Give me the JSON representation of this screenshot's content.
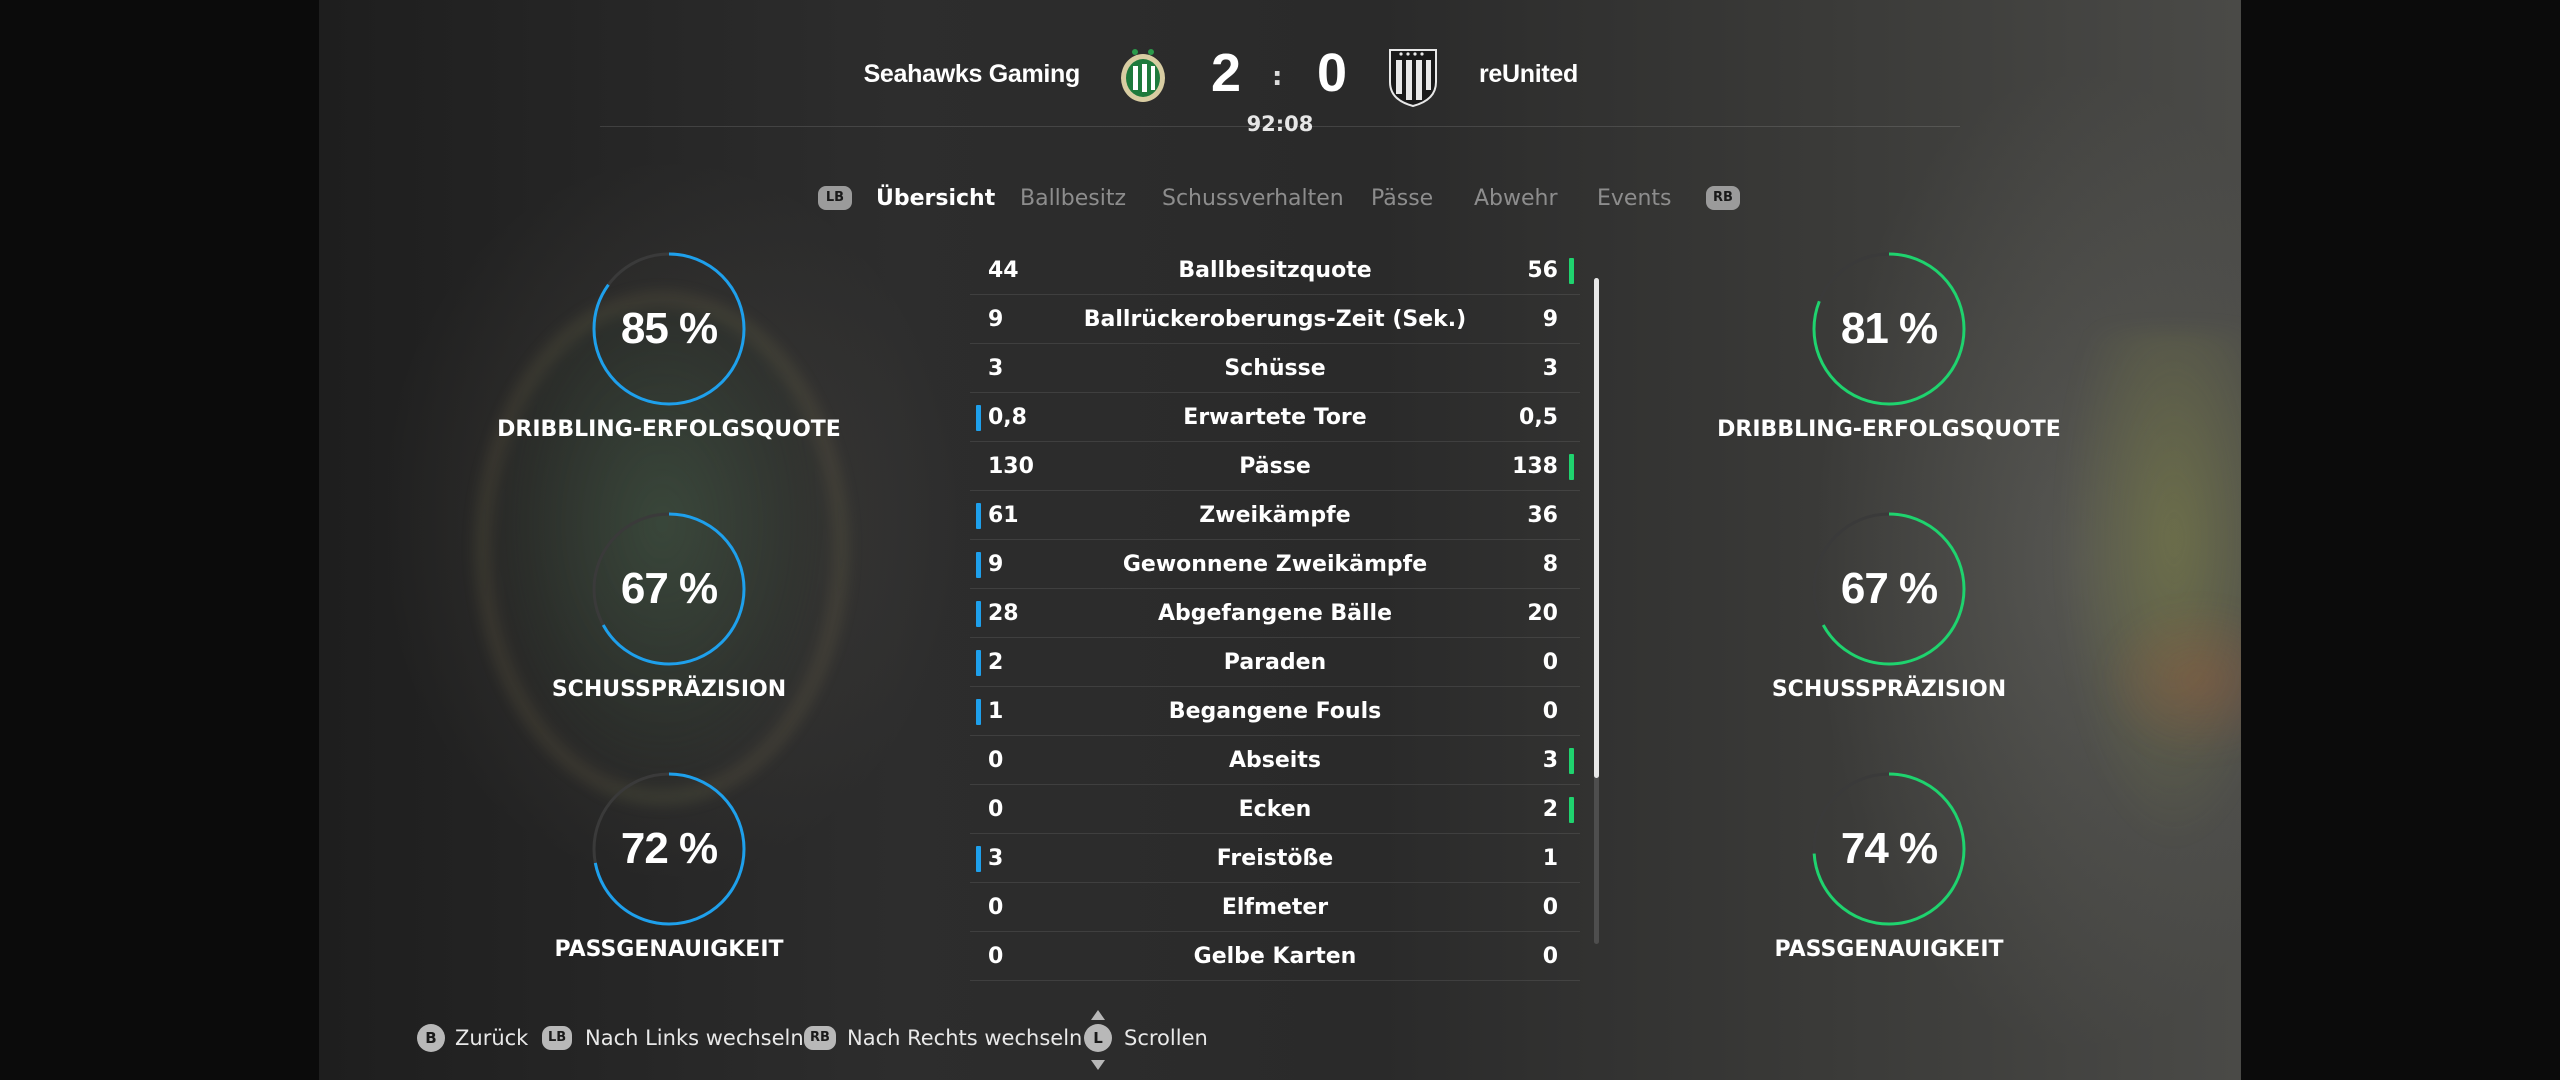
{
  "colors": {
    "home_accent": "#1ea0ec",
    "away_accent": "#1fd36e",
    "track": "#3a3a3a"
  },
  "match": {
    "home_team": "Seahawks Gaming",
    "away_team": "reUnited",
    "home_score": "2",
    "separator": ":",
    "away_score": "0",
    "clock": "92:08",
    "home_crest_icon": "green-white-club-crest-icon",
    "away_crest_icon": "black-white-striped-shield-crest-icon"
  },
  "tabs": {
    "left_button": "LB",
    "right_button": "RB",
    "items": [
      "Übersicht",
      "Ballbesitz",
      "Schussverhalten",
      "Pässe",
      "Abwehr",
      "Events"
    ],
    "active": "Übersicht"
  },
  "home_gauges": [
    {
      "value": "85 %",
      "fraction": 0.85,
      "label": "DRIBBLING-ERFOLGSQUOTE"
    },
    {
      "value": "67 %",
      "fraction": 0.67,
      "label": "SCHUSSPRÄZISION"
    },
    {
      "value": "72 %",
      "fraction": 0.72,
      "label": "PASSGENAUIGKEIT"
    }
  ],
  "away_gauges": [
    {
      "value": "81 %",
      "fraction": 0.81,
      "label": "DRIBBLING-ERFOLGSQUOTE"
    },
    {
      "value": "67 %",
      "fraction": 0.67,
      "label": "SCHUSSPRÄZISION"
    },
    {
      "value": "74 %",
      "fraction": 0.74,
      "label": "PASSGENAUIGKEIT"
    }
  ],
  "stats": [
    {
      "name": "Ballbesitzquote",
      "home": "44",
      "away": "56",
      "leader": "away"
    },
    {
      "name": "Ballrückeroberungs-Zeit (Sek.)",
      "home": "9",
      "away": "9",
      "leader": "none"
    },
    {
      "name": "Schüsse",
      "home": "3",
      "away": "3",
      "leader": "none"
    },
    {
      "name": "Erwartete Tore",
      "home": "0,8",
      "away": "0,5",
      "leader": "home"
    },
    {
      "name": "Pässe",
      "home": "130",
      "away": "138",
      "leader": "away"
    },
    {
      "name": "Zweikämpfe",
      "home": "61",
      "away": "36",
      "leader": "home"
    },
    {
      "name": "Gewonnene Zweikämpfe",
      "home": "9",
      "away": "8",
      "leader": "home"
    },
    {
      "name": "Abgefangene Bälle",
      "home": "28",
      "away": "20",
      "leader": "home"
    },
    {
      "name": "Paraden",
      "home": "2",
      "away": "0",
      "leader": "home"
    },
    {
      "name": "Begangene Fouls",
      "home": "1",
      "away": "0",
      "leader": "home"
    },
    {
      "name": "Abseits",
      "home": "0",
      "away": "3",
      "leader": "away"
    },
    {
      "name": "Ecken",
      "home": "0",
      "away": "2",
      "leader": "away"
    },
    {
      "name": "Freistöße",
      "home": "3",
      "away": "1",
      "leader": "home"
    },
    {
      "name": "Elfmeter",
      "home": "0",
      "away": "0",
      "leader": "none"
    },
    {
      "name": "Gelbe Karten",
      "home": "0",
      "away": "0",
      "leader": "none"
    }
  ],
  "footer": {
    "back_button": "B",
    "back_label": "Zurück",
    "left_button": "LB",
    "left_label": "Nach Links wechseln",
    "right_button": "RB",
    "right_label": "Nach Rechts wechseln",
    "scroll_button": "L",
    "scroll_label": "Scrollen"
  }
}
